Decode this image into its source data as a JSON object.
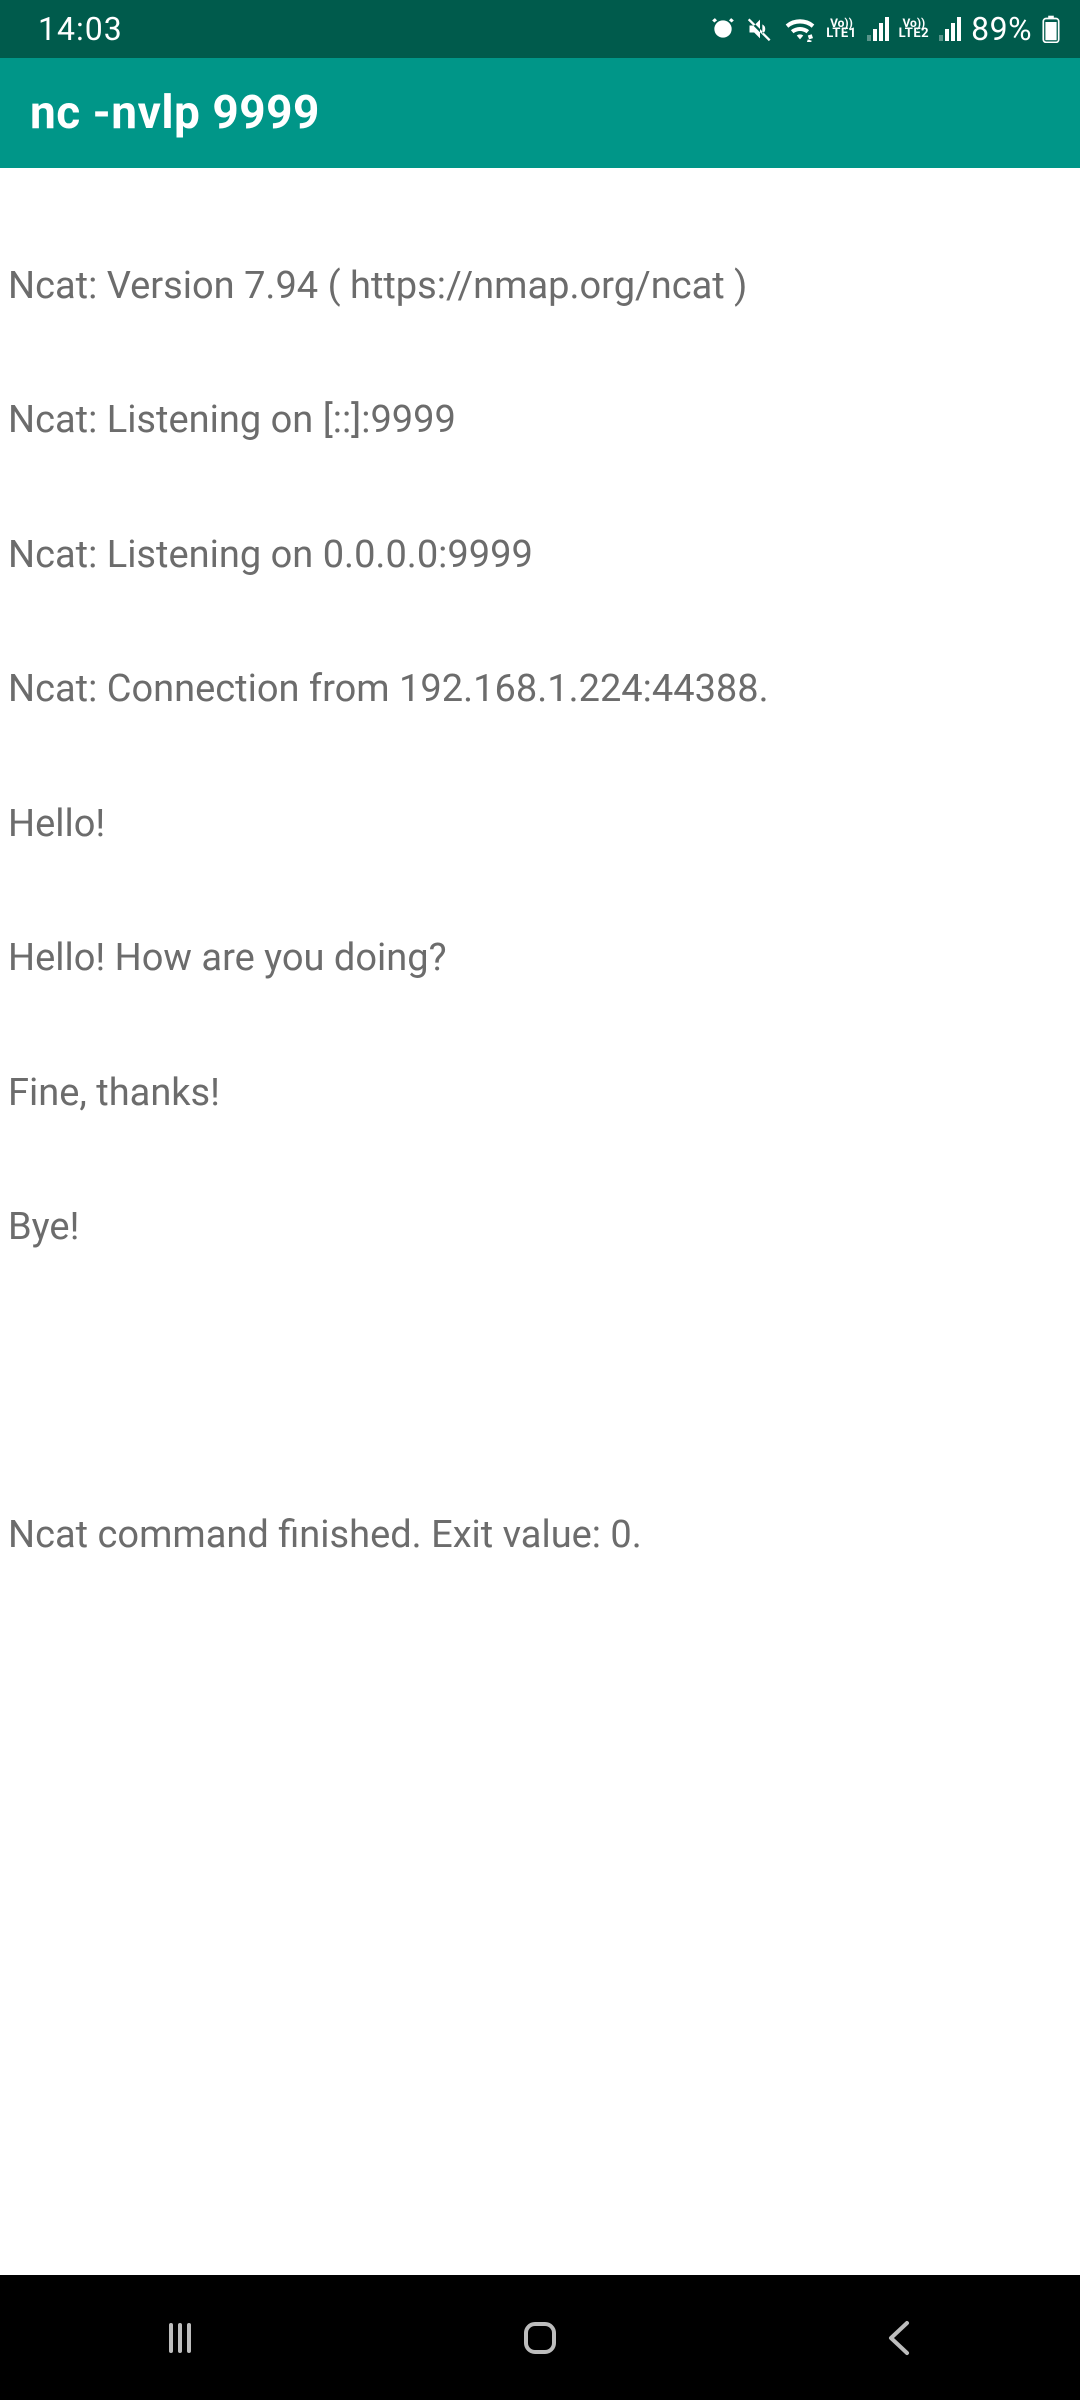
{
  "status_bar": {
    "time": "14:03",
    "battery_pct": "89%",
    "icons": {
      "alarm": "alarm-icon",
      "mute": "mute-icon",
      "wifi": "wifi-icon",
      "volte1_top": "Vo))",
      "volte1_bot": "LTE1",
      "volte2_top": "Vo))",
      "volte2_bot": "LTE2"
    }
  },
  "app_bar": {
    "title": "nc -nvlp 9999"
  },
  "terminal": {
    "lines": [
      "Ncat: Version 7.94 ( https://nmap.org/ncat )",
      "Ncat: Listening on [::]:9999",
      "Ncat: Listening on 0.0.0.0:9999",
      "Ncat: Connection from 192.168.1.224:44388.",
      "Hello!",
      "Hello! How are you doing?",
      "Fine, thanks!",
      "Bye!"
    ],
    "footer": "Ncat command finished. Exit value: 0."
  },
  "nav": {
    "recent": "recent-apps",
    "home": "home",
    "back": "back"
  }
}
